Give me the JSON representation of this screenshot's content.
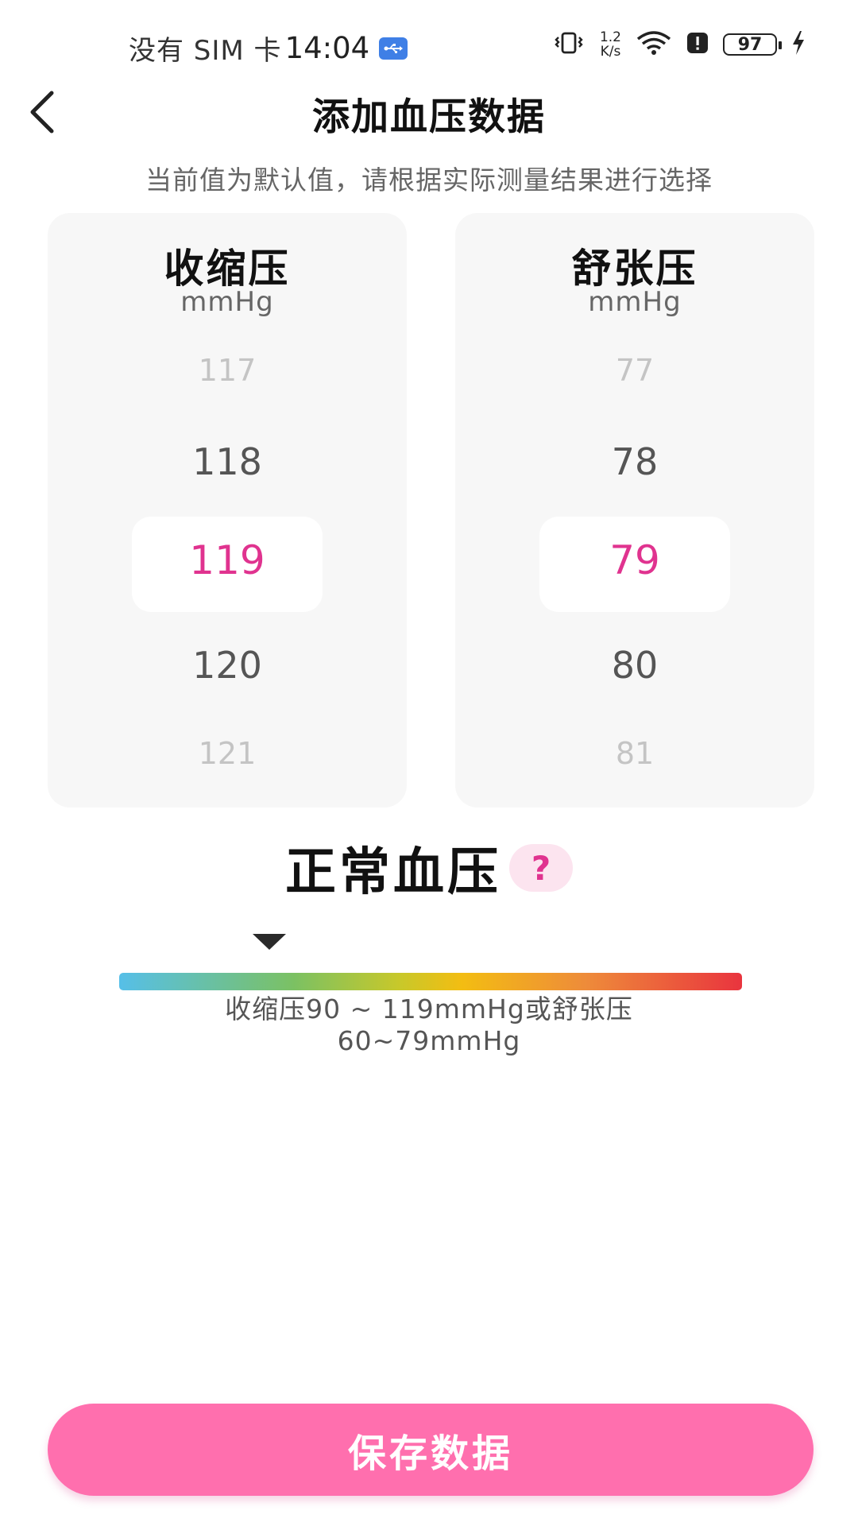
{
  "status_bar": {
    "carrier": "没有 SIM 卡",
    "time": "14:04",
    "net_speed_value": "1.2",
    "net_speed_unit": "K/s",
    "battery": "97",
    "icons": [
      "usb-icon",
      "vibrate-icon",
      "wifi-icon",
      "alert-icon",
      "battery-icon",
      "charging-icon"
    ]
  },
  "header": {
    "title": "添加血压数据",
    "back_icon": "chevron-left-icon"
  },
  "hint": "当前值为默认值，请根据实际测量结果进行选择",
  "systolic": {
    "title": "收缩压",
    "unit": "mmHg",
    "values": [
      "117",
      "118",
      "119",
      "120",
      "121"
    ],
    "selected": "119"
  },
  "diastolic": {
    "title": "舒张压",
    "unit": "mmHg",
    "values": [
      "77",
      "78",
      "79",
      "80",
      "81"
    ],
    "selected": "79"
  },
  "result": {
    "status": "正常血压",
    "help_label": "?",
    "range_line1": "收缩压90 ~ 119mmHg或舒张压",
    "range_line2": "60~79mmHg",
    "accent": "#e0338f"
  },
  "save_button": "保存数据",
  "colors": {
    "accent": "#e0338f",
    "button": "#ff6fae",
    "card": "#f7f7f7"
  }
}
